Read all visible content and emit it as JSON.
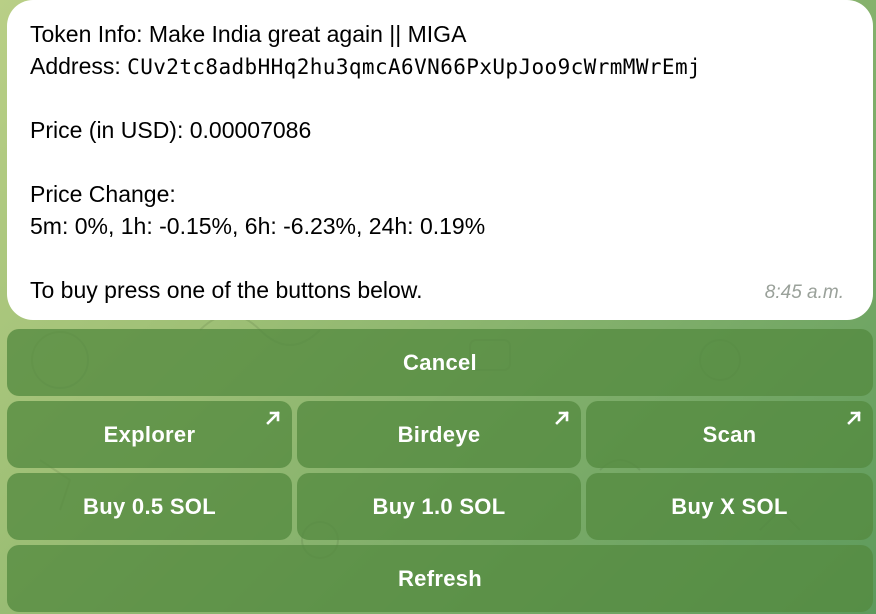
{
  "message": {
    "lines": [
      "Token Info: Make India great again || MIGA",
      "Address: CUv2tc8adbHHq2hu3qmcA6VN66PxUpJoo9cWrmMWrEmj",
      "",
      "Price (in USD): 0.00007086",
      "",
      "Price Change:",
      "5m: 0%, 1h: -0.15%, 6h: -6.23%, 24h: 0.19%",
      "",
      "To buy press one of the buttons below."
    ],
    "address_label": "Address: ",
    "address_value": "CUv2tc8adbHHq2hu3qmcA6VN66PxUpJoo9cWrmMWrEmj",
    "time": "8:45 a.m."
  },
  "keyboard": {
    "cancel": "Cancel",
    "explorer": "Explorer",
    "birdeye": "Birdeye",
    "scan": "Scan",
    "buy_05": "Buy 0.5 SOL",
    "buy_10": "Buy 1.0 SOL",
    "buy_x": "Buy X SOL",
    "refresh": "Refresh"
  },
  "colors": {
    "button_bg": "#5a8d44",
    "bubble_bg": "#ffffff",
    "timestamp": "#9aa19a"
  }
}
